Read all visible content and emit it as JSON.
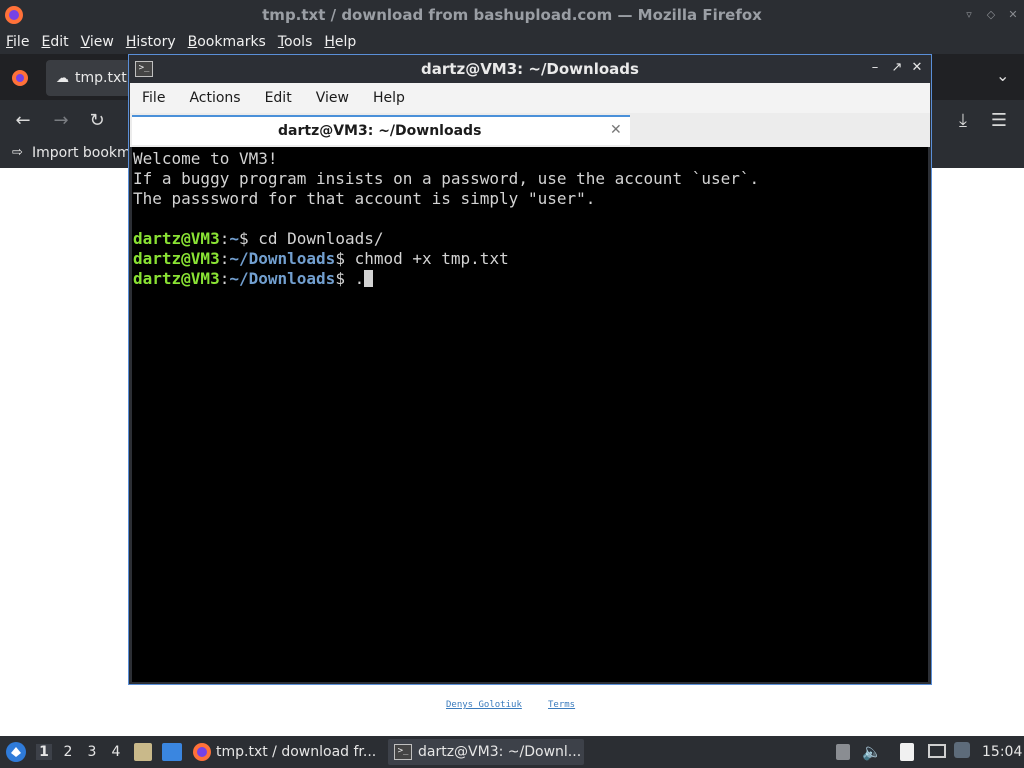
{
  "firefox": {
    "window_title": "tmp.txt / download from bashupload.com — Mozilla Firefox",
    "menu": [
      "File",
      "Edit",
      "View",
      "History",
      "Bookmarks",
      "Tools",
      "Help"
    ],
    "tab_title": "tmp.txt",
    "bookmarks_item": "Import bookm",
    "footer_links": [
      "Denys Golotiuk",
      "Terms"
    ]
  },
  "terminal": {
    "window_title": "dartz@VM3: ~/Downloads",
    "menu": [
      "File",
      "Actions",
      "Edit",
      "View",
      "Help"
    ],
    "tab_title": "dartz@VM3: ~/Downloads",
    "motd": [
      "Welcome to VM3!",
      "If a buggy program insists on a password, use the account `user`.",
      "The passsword for that account is simply \"user\"."
    ],
    "prompt_user": "dartz@VM3",
    "sessions": [
      {
        "path": "~",
        "command": "cd Downloads/"
      },
      {
        "path": "~/Downloads",
        "command": "chmod +x tmp.txt"
      },
      {
        "path": "~/Downloads",
        "command": "."
      }
    ]
  },
  "taskbar": {
    "workspaces": [
      "1",
      "2",
      "3",
      "4"
    ],
    "tasks": [
      "tmp.txt / download fr...",
      "dartz@VM3: ~/Downl..."
    ],
    "clock": "15:04"
  },
  "colors": {
    "prompt_user": "#8ae234",
    "prompt_path": "#729fcf",
    "terminal_bg": "#000000",
    "accent": "#4a90d9"
  }
}
